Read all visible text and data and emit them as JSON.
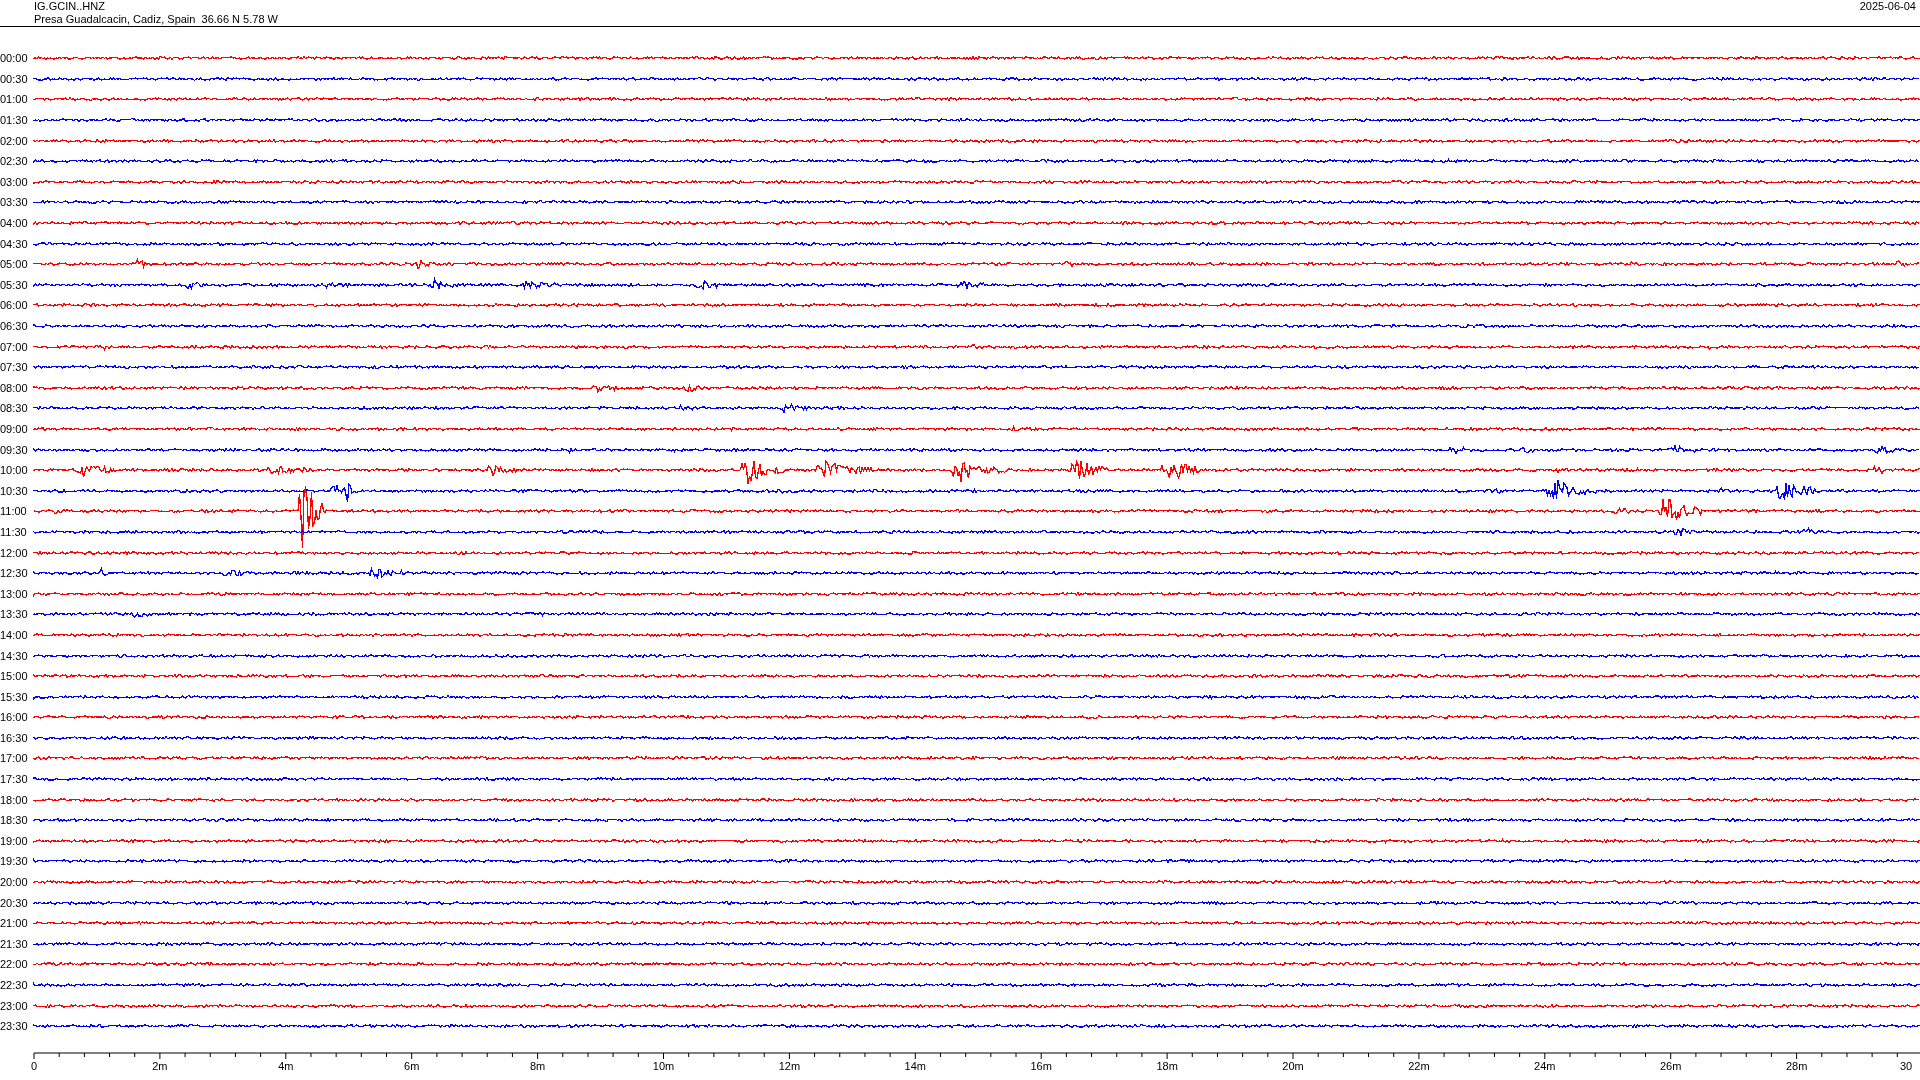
{
  "header": {
    "station": "IG.GCIN..HNZ",
    "location": "Presa Guadalcacin, Cadiz, Spain  36.66 N 5.78 W",
    "date": "2025-06-04"
  },
  "rows": [
    {
      "time": "00:00",
      "color": "#ff0000"
    },
    {
      "time": "00:30",
      "color": "#0000ff"
    },
    {
      "time": "01:00",
      "color": "#ff0000"
    },
    {
      "time": "01:30",
      "color": "#0000ff"
    },
    {
      "time": "02:00",
      "color": "#ff0000"
    },
    {
      "time": "02:30",
      "color": "#0000ff"
    },
    {
      "time": "03:00",
      "color": "#ff0000"
    },
    {
      "time": "03:30",
      "color": "#0000ff"
    },
    {
      "time": "04:00",
      "color": "#ff0000"
    },
    {
      "time": "04:30",
      "color": "#0000ff"
    },
    {
      "time": "05:00",
      "color": "#ff0000"
    },
    {
      "time": "05:30",
      "color": "#0000ff"
    },
    {
      "time": "06:00",
      "color": "#ff0000"
    },
    {
      "time": "06:30",
      "color": "#0000ff"
    },
    {
      "time": "07:00",
      "color": "#ff0000"
    },
    {
      "time": "07:30",
      "color": "#0000ff"
    },
    {
      "time": "08:00",
      "color": "#ff0000"
    },
    {
      "time": "08:30",
      "color": "#0000ff"
    },
    {
      "time": "09:00",
      "color": "#ff0000"
    },
    {
      "time": "09:30",
      "color": "#0000ff"
    },
    {
      "time": "10:00",
      "color": "#ff0000"
    },
    {
      "time": "10:30",
      "color": "#0000ff"
    },
    {
      "time": "11:00",
      "color": "#ff0000"
    },
    {
      "time": "11:30",
      "color": "#0000ff"
    },
    {
      "time": "12:00",
      "color": "#ff0000"
    },
    {
      "time": "12:30",
      "color": "#0000ff"
    },
    {
      "time": "13:00",
      "color": "#ff0000"
    },
    {
      "time": "13:30",
      "color": "#0000ff"
    },
    {
      "time": "14:00",
      "color": "#ff0000"
    },
    {
      "time": "14:30",
      "color": "#0000ff"
    },
    {
      "time": "15:00",
      "color": "#ff0000"
    },
    {
      "time": "15:30",
      "color": "#0000ff"
    },
    {
      "time": "16:00",
      "color": "#ff0000"
    },
    {
      "time": "16:30",
      "color": "#0000ff"
    },
    {
      "time": "17:00",
      "color": "#ff0000"
    },
    {
      "time": "17:30",
      "color": "#0000ff"
    },
    {
      "time": "18:00",
      "color": "#ff0000"
    },
    {
      "time": "18:30",
      "color": "#0000ff"
    },
    {
      "time": "19:00",
      "color": "#ff0000"
    },
    {
      "time": "19:30",
      "color": "#0000ff"
    },
    {
      "time": "20:00",
      "color": "#ff0000"
    },
    {
      "time": "20:30",
      "color": "#0000ff"
    },
    {
      "time": "21:00",
      "color": "#ff0000"
    },
    {
      "time": "21:30",
      "color": "#0000ff"
    },
    {
      "time": "22:00",
      "color": "#ff0000"
    },
    {
      "time": "22:30",
      "color": "#0000ff"
    },
    {
      "time": "23:00",
      "color": "#ff0000"
    },
    {
      "time": "23:30",
      "color": "#0000ff"
    }
  ],
  "axis": {
    "labels": [
      "0",
      "2m",
      "4m",
      "6m",
      "8m",
      "10m",
      "12m",
      "14m",
      "16m",
      "18m",
      "20m",
      "22m",
      "24m",
      "26m",
      "28m",
      "30"
    ]
  }
}
